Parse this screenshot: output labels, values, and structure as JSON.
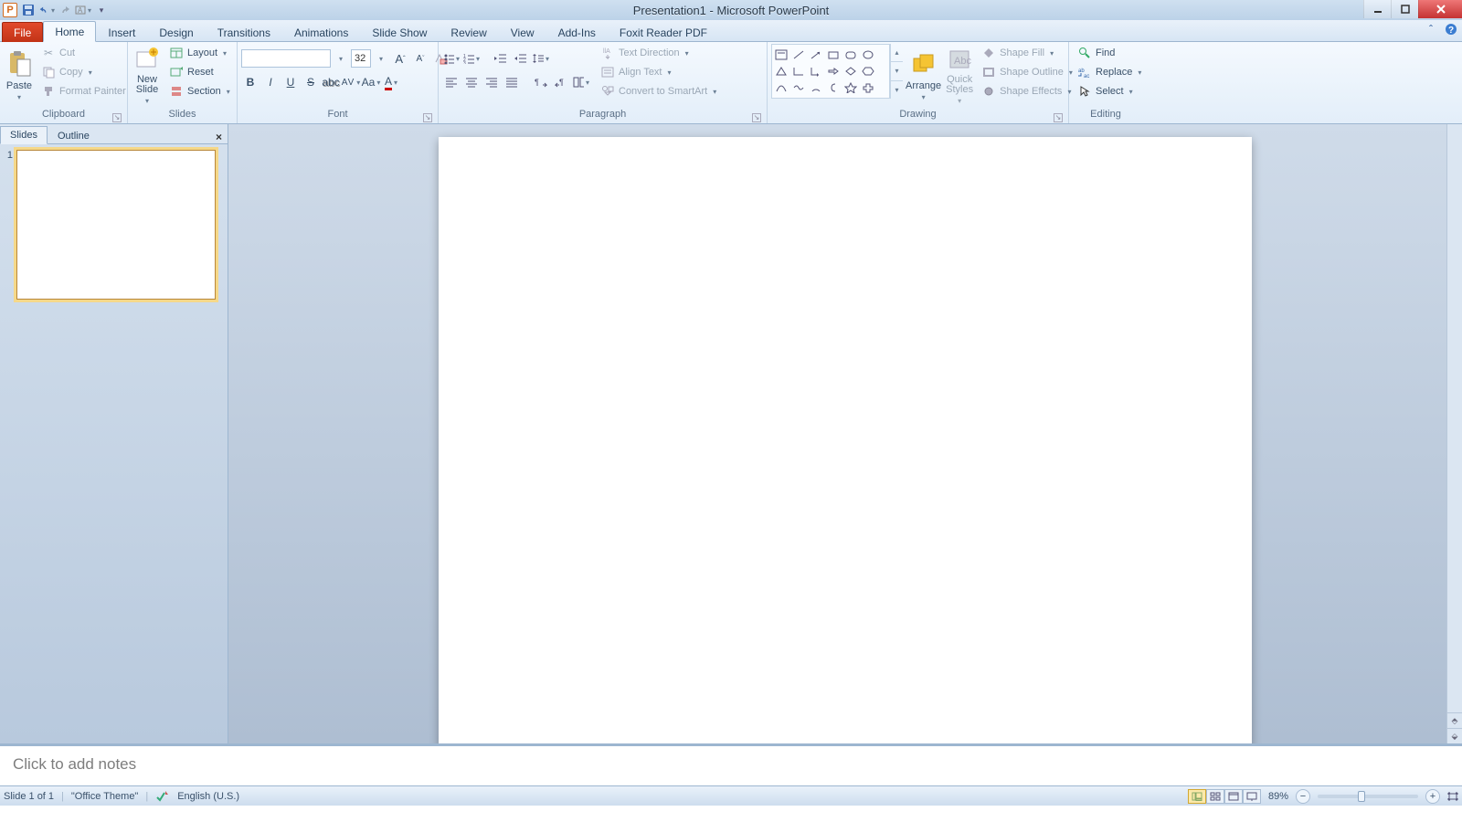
{
  "title": "Presentation1 - Microsoft PowerPoint",
  "tabs": {
    "file": "File",
    "list": [
      "Home",
      "Insert",
      "Design",
      "Transitions",
      "Animations",
      "Slide Show",
      "Review",
      "View",
      "Add-Ins",
      "Foxit Reader PDF"
    ],
    "active": "Home"
  },
  "ribbon": {
    "clipboard": {
      "label": "Clipboard",
      "paste": "Paste",
      "cut": "Cut",
      "copy": "Copy",
      "fmt": "Format Painter"
    },
    "slides": {
      "label": "Slides",
      "new": "New\nSlide",
      "layout": "Layout",
      "reset": "Reset",
      "section": "Section"
    },
    "font": {
      "label": "Font",
      "name": "",
      "size": "32"
    },
    "paragraph": {
      "label": "Paragraph",
      "textdir": "Text Direction",
      "align": "Align Text",
      "smart": "Convert to SmartArt"
    },
    "drawing": {
      "label": "Drawing",
      "arrange": "Arrange",
      "quick": "Quick\nStyles",
      "fill": "Shape Fill",
      "outline": "Shape Outline",
      "effects": "Shape Effects"
    },
    "editing": {
      "label": "Editing",
      "find": "Find",
      "replace": "Replace",
      "select": "Select"
    }
  },
  "side": {
    "slides": "Slides",
    "outline": "Outline",
    "num": "1"
  },
  "notes": {
    "placeholder": "Click to add notes"
  },
  "status": {
    "slide": "Slide 1 of 1",
    "theme": "\"Office Theme\"",
    "lang": "English (U.S.)",
    "zoom": "89%"
  }
}
